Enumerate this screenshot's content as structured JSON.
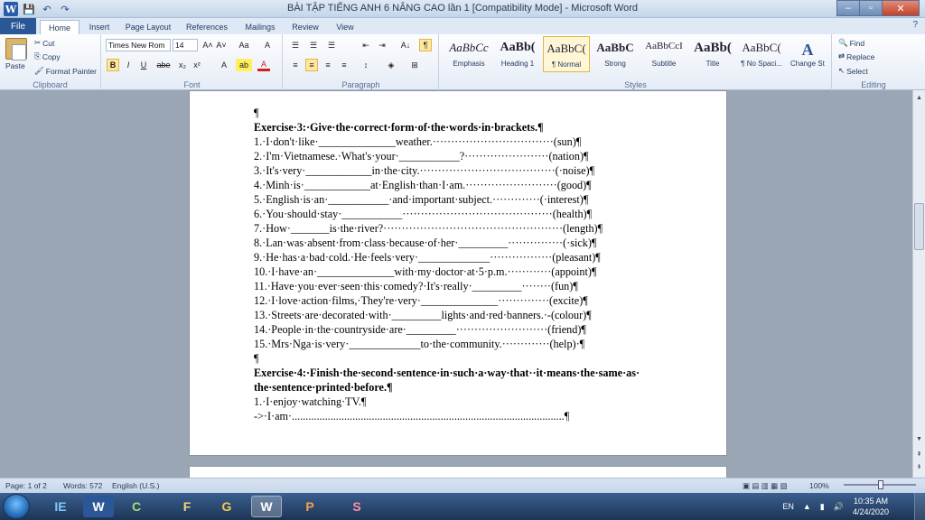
{
  "window": {
    "title": "BÀI TẬP TIẾNG ANH 6  NÂNG CAO lần 1 [Compatibility Mode] - Microsoft Word",
    "minimize": "–",
    "maximize": "▫",
    "close": "✕"
  },
  "qat": {
    "app_icon": "W",
    "save": "💾",
    "undo": "↶",
    "redo": "↷"
  },
  "tabs": [
    "File",
    "Home",
    "Insert",
    "Page Layout",
    "References",
    "Mailings",
    "Review",
    "View"
  ],
  "active_tab": "Home",
  "help_icon": "?",
  "ribbon": {
    "clipboard": {
      "label": "Clipboard",
      "paste": "Paste",
      "cut": "Cut",
      "copy": "Copy",
      "format_painter": "Format Painter"
    },
    "font": {
      "label": "Font",
      "font_name": "Times New Rom",
      "font_size": "14",
      "bold": "B",
      "italic": "I",
      "underline": "U",
      "strike": "abe",
      "subscript": "x₂",
      "superscript": "x²",
      "grow": "A˄",
      "shrink": "A˅",
      "case": "Aa",
      "clear": "A",
      "highlight": "ab",
      "color": "A"
    },
    "paragraph": {
      "label": "Paragraph",
      "pilcrow": "¶",
      "bullets": "☰",
      "numbering": "☰",
      "multilevel": "☰",
      "decrease_indent": "⇤",
      "increase_indent": "⇥",
      "sort": "A↓",
      "align_left": "≡",
      "center": "≡",
      "align_right": "≡",
      "justify": "≡",
      "line_spacing": "↕",
      "shading": "◈",
      "borders": "⊞"
    },
    "styles": {
      "label": "Styles",
      "items": [
        {
          "sample": "AaBbCc",
          "name": "Emphasis"
        },
        {
          "sample": "AaBb(",
          "name": "Heading 1"
        },
        {
          "sample": "AaBbC(",
          "name": "¶ Normal"
        },
        {
          "sample": "AaBbC",
          "name": "Strong"
        },
        {
          "sample": "AaBbCcI",
          "name": "Subtitle"
        },
        {
          "sample": "AaBb(",
          "name": "Title"
        },
        {
          "sample": "AaBbC(",
          "name": "¶ No Spaci..."
        }
      ],
      "change_styles": "Change Styles"
    },
    "editing": {
      "label": "Editing",
      "find": "Find",
      "replace": "Replace",
      "select": "Select"
    }
  },
  "document": {
    "lines": [
      {
        "text": "¶",
        "bold": false
      },
      {
        "text": "Exercise·3:·Give·the·correct·form·of·the·words·in·brackets.¶",
        "bold": true
      },
      {
        "text": "1.·I·don't·like·______________weather.·································(sun)¶",
        "bold": false
      },
      {
        "text": "2.·I'm·Vietnamese.·What's·your·___________?·······················(nation)¶",
        "bold": false
      },
      {
        "text": "3.·It's·very·____________in·the·city.·····································(·noise)¶",
        "bold": false
      },
      {
        "text": "4.·Minh·is·____________at·English·than·I·am.·························(good)¶",
        "bold": false
      },
      {
        "text": "5.·English·is·an·___________·and·important·subject.·············(·interest)¶",
        "bold": false
      },
      {
        "text": "6.·You·should·stay·___________·········································(health)¶",
        "bold": false
      },
      {
        "text": "7.·How·_______is·the·river?·················································(length)¶",
        "bold": false
      },
      {
        "text": "8.·Lan·was·absent·from·class·because·of·her·_________···············(·sick)¶",
        "bold": false
      },
      {
        "text": "9.·He·has·a·bad·cold.·He·feels·very·_____________·················(pleasant)¶",
        "bold": false
      },
      {
        "text": "10.·I·have·an·______________with·my·doctor·at·5·p.m.············(appoint)¶",
        "bold": false
      },
      {
        "text": "11.·Have·you·ever·seen·this·comedy?·It's·really·_________········(fun)¶",
        "bold": false
      },
      {
        "text": "12.·I·love·action·films,·They're·very·______________··············(excite)¶",
        "bold": false
      },
      {
        "text": "13.·Streets·are·decorated·with·_________lights·and·red·banners.·-(colour)¶",
        "bold": false
      },
      {
        "text": "14.·People·in·the·countryside·are·_________·························(friend)¶",
        "bold": false
      },
      {
        "text": "15.·Mrs·Nga·is·very·_____________to·the·community.·············(help)·¶",
        "bold": false
      },
      {
        "text": "¶",
        "bold": false
      },
      {
        "text": "Exercise·4:·Finish·the·second·sentence·in·such·a·way·that··it·means·the·same·as·",
        "bold": true
      },
      {
        "text": "the·sentence·printed·before.¶",
        "bold": true
      },
      {
        "text": "1.·I·enjoy·watching·TV.¶",
        "bold": false
      },
      {
        "text": "->·I·am·...................................................................................................¶",
        "bold": false
      }
    ]
  },
  "status": {
    "page": "Page: 1 of 2",
    "words": "Words: 572",
    "language": "English (U.S.)",
    "zoom": "100%"
  },
  "taskbar": {
    "apps": [
      "IE",
      "W",
      "C",
      "F",
      "G",
      "W",
      "P",
      "S"
    ],
    "lang": "EN",
    "time": "10:35 AM",
    "date": "4/24/2020"
  }
}
